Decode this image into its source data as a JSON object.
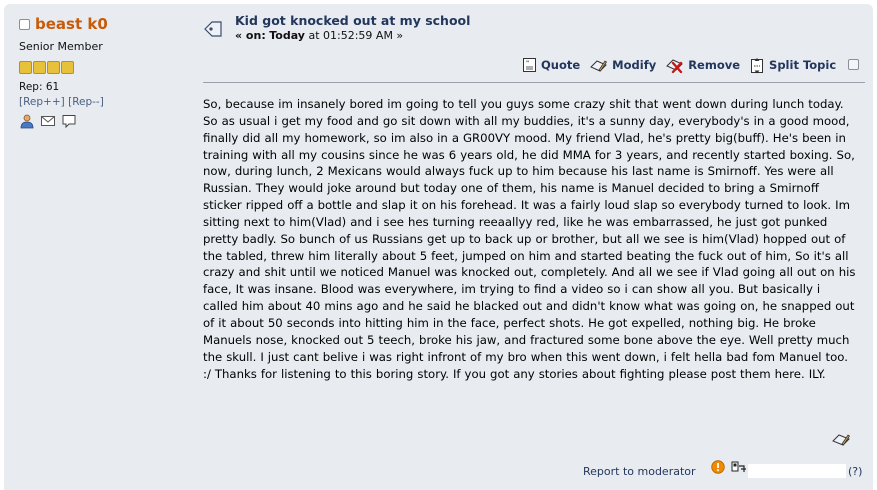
{
  "poster": {
    "name": "beast k0",
    "rank": "Senior Member",
    "stars": 4,
    "rep": "Rep: 61",
    "rep_plus": "[Rep++]",
    "rep_minus": "[Rep--]",
    "icons": [
      "profile-icon",
      "email-icon",
      "pm-icon"
    ]
  },
  "post": {
    "subject": "Kid got knocked out at my school",
    "meta_prefix": "« on:",
    "meta_day": "Today",
    "meta_time": "at 01:52:59 AM »",
    "body": "So, because im insanely bored im going to tell you guys some crazy shit that went down during lunch today. So as usual i get my food and go sit down with all my buddies, it's a sunny day, everybody's in a good mood, finally did all my homework, so im also in a GR00VY mood. My friend Vlad, he's pretty big(buff). He's been in training with all my cousins since he was 6 years old, he did MMA for 3 years, and recently started boxing. So, now, during lunch, 2 Mexicans would always fuck up to him because his last name is Smirnoff. Yes were all Russian. They would joke around but today one of them, his name is Manuel decided to bring a Smirnoff sticker ripped off a bottle and slap it on his forehead. It was a fairly loud slap so everybody turned to look. Im sitting next to him(Vlad) and i see hes turning reeaallyy red, like he was embarrassed, he just got punked pretty badly. So bunch of us Russians get up to back up or brother, but all we see is him(Vlad) hopped out of the tabled, threw him literally about 5 feet, jumped on him and started beating the fuck out of him, So it's all crazy and shit until we noticed Manuel was knocked out, completely. And all we see if Vlad going all out on his face, It was insane. Blood was everywhere, im trying to find a video so i can show all you. But basically i called him about 40 mins ago and he said he blacked out and didn't know what was going on, he snapped out of it about 50 seconds into hitting him in the face, perfect shots. He got expelled, nothing big. He broke Manuels nose, knocked out 5 teech, broke his jaw, and fractured some bone above the eye. Well pretty much the skull. I just cant belive i was right infront of my bro when this went down, i felt hella bad fom Manuel too. :/ Thanks for listening to this boring story. If you got any stories about fighting please post them here. ILY."
  },
  "buttons": {
    "quote": "Quote",
    "modify": "Modify",
    "remove": "Remove",
    "split": "Split Topic"
  },
  "footer": {
    "report": "Report to moderator",
    "ip_help": "(?)"
  },
  "colors": {
    "background": "#e8ecf1",
    "name": "#c75b0a",
    "link": "#23365c"
  }
}
